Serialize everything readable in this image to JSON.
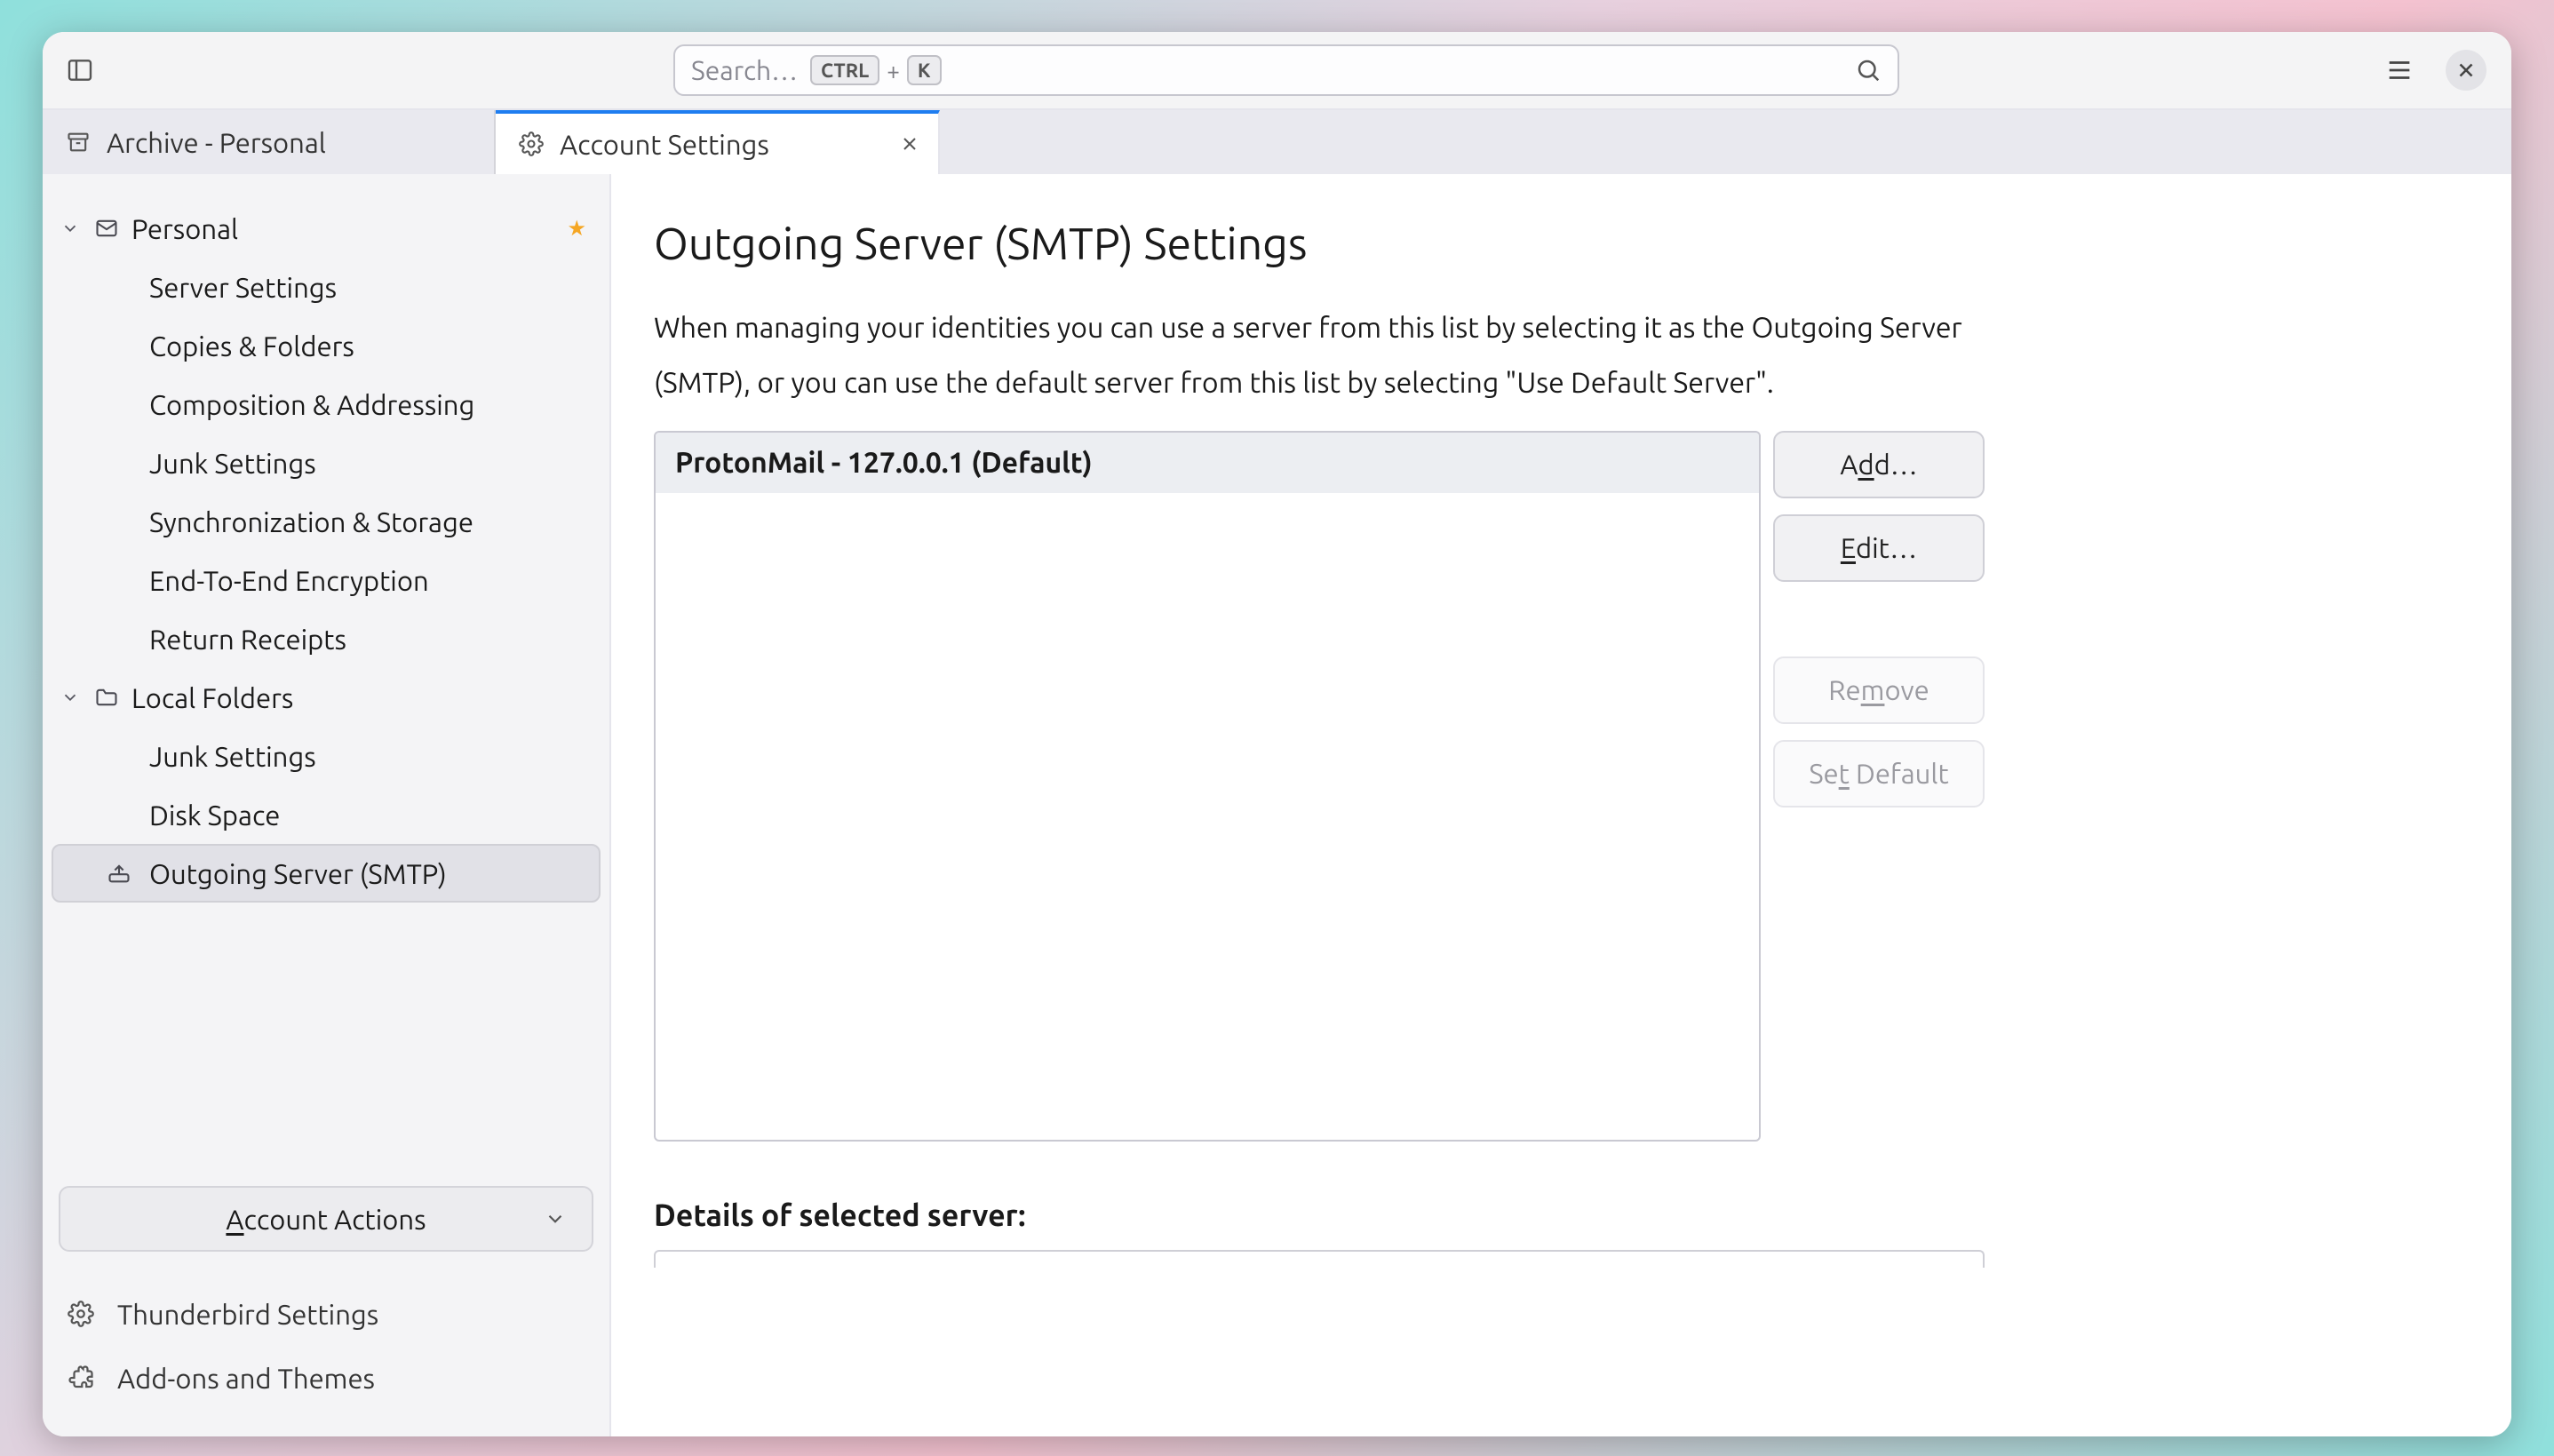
{
  "toolbar": {
    "search_placeholder": "Search…",
    "kbd_ctrl": "CTRL",
    "kbd_plus": "+",
    "kbd_k": "K"
  },
  "tabs": [
    {
      "label": "Archive - Personal",
      "active": false
    },
    {
      "label": "Account Settings",
      "active": true
    }
  ],
  "sidebar": {
    "accounts": [
      {
        "name": "Personal",
        "default": true,
        "items": [
          "Server Settings",
          "Copies & Folders",
          "Composition & Addressing",
          "Junk Settings",
          "Synchronization & Storage",
          "End-To-End Encryption",
          "Return Receipts"
        ]
      },
      {
        "name": "Local Folders",
        "items": [
          "Junk Settings",
          "Disk Space"
        ]
      }
    ],
    "smtp_label": "Outgoing Server (SMTP)",
    "account_actions": "Account Actions",
    "settings_link": "Thunderbird Settings",
    "addons_link": "Add-ons and Themes"
  },
  "main": {
    "title": "Outgoing Server (SMTP) Settings",
    "description": "When managing your identities you can use a server from this list by selecting it as the Outgoing Server (SMTP), or you can use the default server from this list by selecting \"Use Default Server\".",
    "servers": [
      {
        "label": "ProtonMail - 127.0.0.1 (Default)",
        "selected": true
      }
    ],
    "buttons": {
      "add": {
        "pre": "A",
        "u": "d",
        "post": "d…"
      },
      "edit": {
        "pre": "",
        "u": "E",
        "post": "dit…"
      },
      "remove": {
        "pre": "Re",
        "u": "m",
        "post": "ove"
      },
      "setdefault": {
        "pre": "Se",
        "u": "t",
        "post": " Default"
      }
    },
    "details_heading": "Details of selected server:"
  },
  "account_actions_btn": {
    "pre": "",
    "u": "A",
    "post": "ccount Actions"
  }
}
